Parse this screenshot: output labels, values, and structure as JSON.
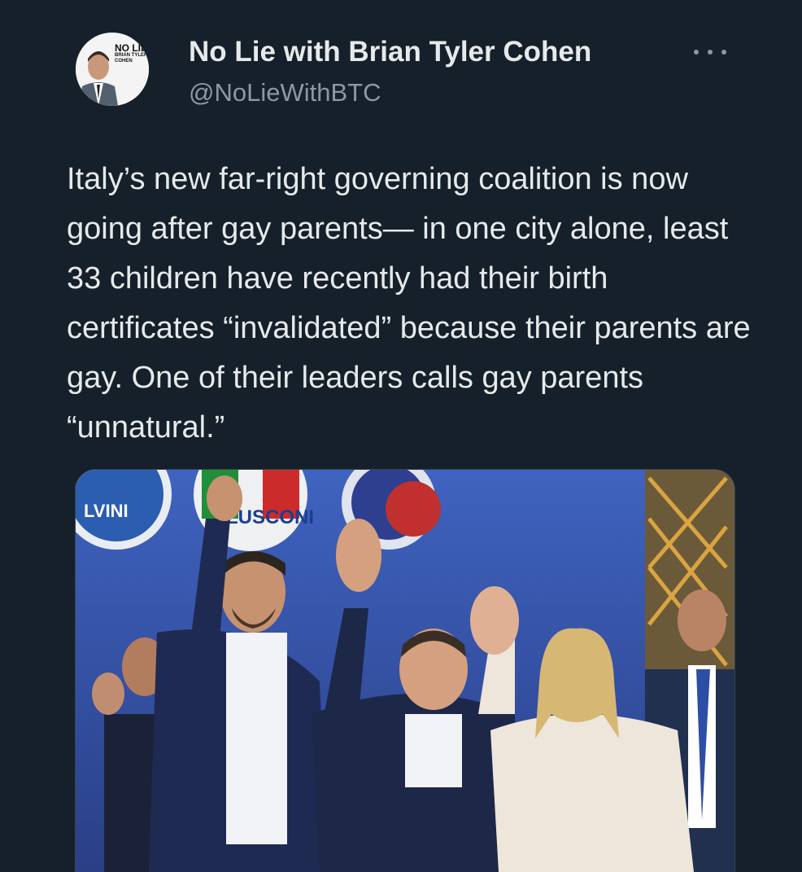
{
  "tweet": {
    "author": {
      "display_name": "No Lie with Brian Tyler Cohen",
      "handle": "@NoLieWithBTC",
      "avatar_text": "NO LIE",
      "avatar_subtext": "BRIAN TYLER COHEN"
    },
    "text": "Italy’s new far-right governing coalition is now going after gay parents— in one city alone, least 33 children have recently had their birth certificates “invalidated” because their parents are gay. One of their leaders calls gay parents “unnatural.”",
    "media": {
      "banner_text_1": "LVINI",
      "banner_text_2": "LUSCONI"
    }
  },
  "colors": {
    "background": "#15202b",
    "primary_text": "#e7e9ea",
    "secondary_text": "#8b98a5",
    "border": "#38444d"
  },
  "icons": {
    "more": "more-horizontal-icon"
  }
}
